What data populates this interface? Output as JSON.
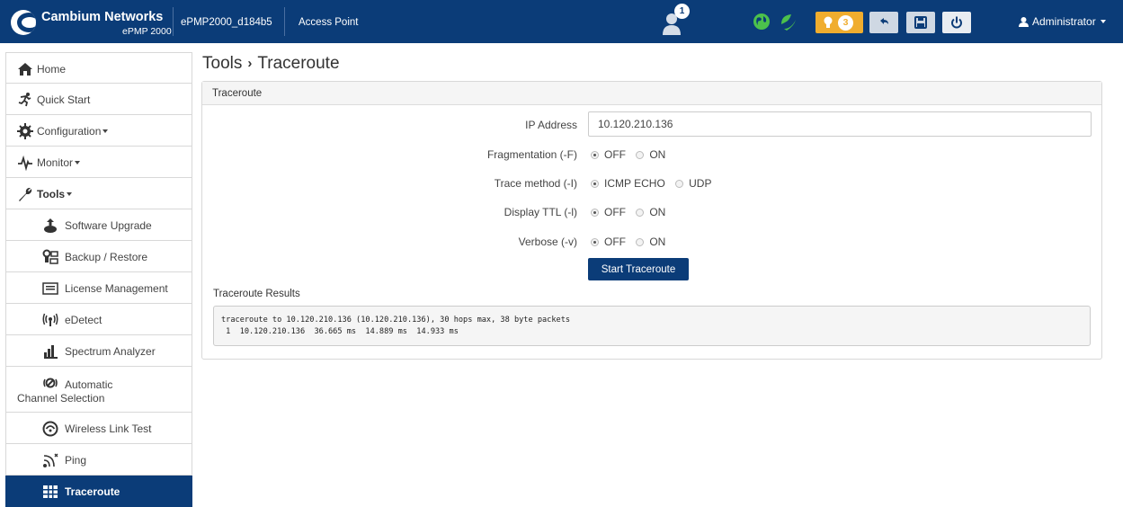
{
  "header": {
    "brand_name": "Cambium Networks",
    "brand_sub": "ePMP 2000",
    "device_name": "ePMP2000_d184b5",
    "mode": "Access Point",
    "user_badge_count": "1",
    "alerts_count": "3",
    "user_menu": "Administrator",
    "colors": {
      "navbar": "#0b3c78",
      "alert": "#f0ad2e",
      "globe": "#4cc14c"
    }
  },
  "sidebar": {
    "items": [
      {
        "label": "Home",
        "icon": "home-icon"
      },
      {
        "label": "Quick Start",
        "icon": "running-person-icon"
      },
      {
        "label": "Configuration",
        "icon": "gear-icon"
      },
      {
        "label": "Monitor",
        "icon": "pulse-icon"
      },
      {
        "label": "Tools",
        "icon": "wrench-icon"
      },
      {
        "label": "Software Upgrade",
        "icon": "upload-icon"
      },
      {
        "label": "Backup / Restore",
        "icon": "backup-icon"
      },
      {
        "label": "License Management",
        "icon": "license-icon"
      },
      {
        "label": "eDetect",
        "icon": "edetect-icon"
      },
      {
        "label": "Spectrum Analyzer",
        "icon": "bar-chart-icon"
      },
      {
        "label": "Automatic Channel Selection",
        "icon": "channel-icon"
      },
      {
        "label": "Wireless Link Test",
        "icon": "speedometer-icon"
      },
      {
        "label": "Ping",
        "icon": "ping-icon"
      },
      {
        "label": "Traceroute",
        "icon": "traceroute-icon"
      }
    ]
  },
  "page": {
    "breadcrumb_parent": "Tools",
    "breadcrumb_sep": "›",
    "title": "Traceroute"
  },
  "panel": {
    "title": "Traceroute",
    "ip_label": "IP Address",
    "ip_value": "10.120.210.136",
    "fragmentation": {
      "label": "Fragmentation (-F)",
      "opt1": "OFF",
      "opt2": "ON",
      "selected": "OFF"
    },
    "trace_method": {
      "label": "Trace method (-I)",
      "opt1": "ICMP ECHO",
      "opt2": "UDP",
      "selected": "ICMP ECHO"
    },
    "display_ttl": {
      "label": "Display TTL (-l)",
      "opt1": "OFF",
      "opt2": "ON",
      "selected": "OFF"
    },
    "verbose": {
      "label": "Verbose (-v)",
      "opt1": "OFF",
      "opt2": "ON",
      "selected": "OFF"
    },
    "start_button": "Start Traceroute",
    "results_label": "Traceroute Results",
    "results_lines": [
      "traceroute to 10.120.210.136 (10.120.210.136), 30 hops max, 38 byte packets",
      " 1  10.120.210.136  36.665 ms  14.889 ms  14.933 ms"
    ]
  }
}
